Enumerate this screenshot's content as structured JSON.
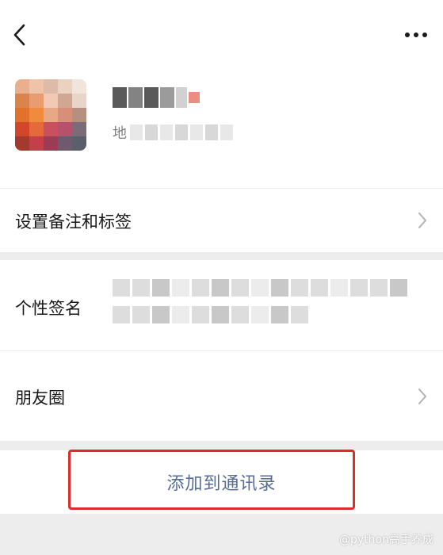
{
  "nav": {
    "back_icon": "chevron-left-icon",
    "more_icon": "more-dots-icon"
  },
  "profile": {
    "region_prefix": "地"
  },
  "cells": {
    "remark_label": "设置备注和标签",
    "signature_label": "个性签名",
    "moments_label": "朋友圈"
  },
  "actions": {
    "add_contact_label": "添加到通讯录"
  },
  "watermark": {
    "text": "@python高手养成"
  },
  "colors": {
    "link_blue": "#576b95",
    "highlight_red": "#e02b2b",
    "background": "#ededed"
  }
}
